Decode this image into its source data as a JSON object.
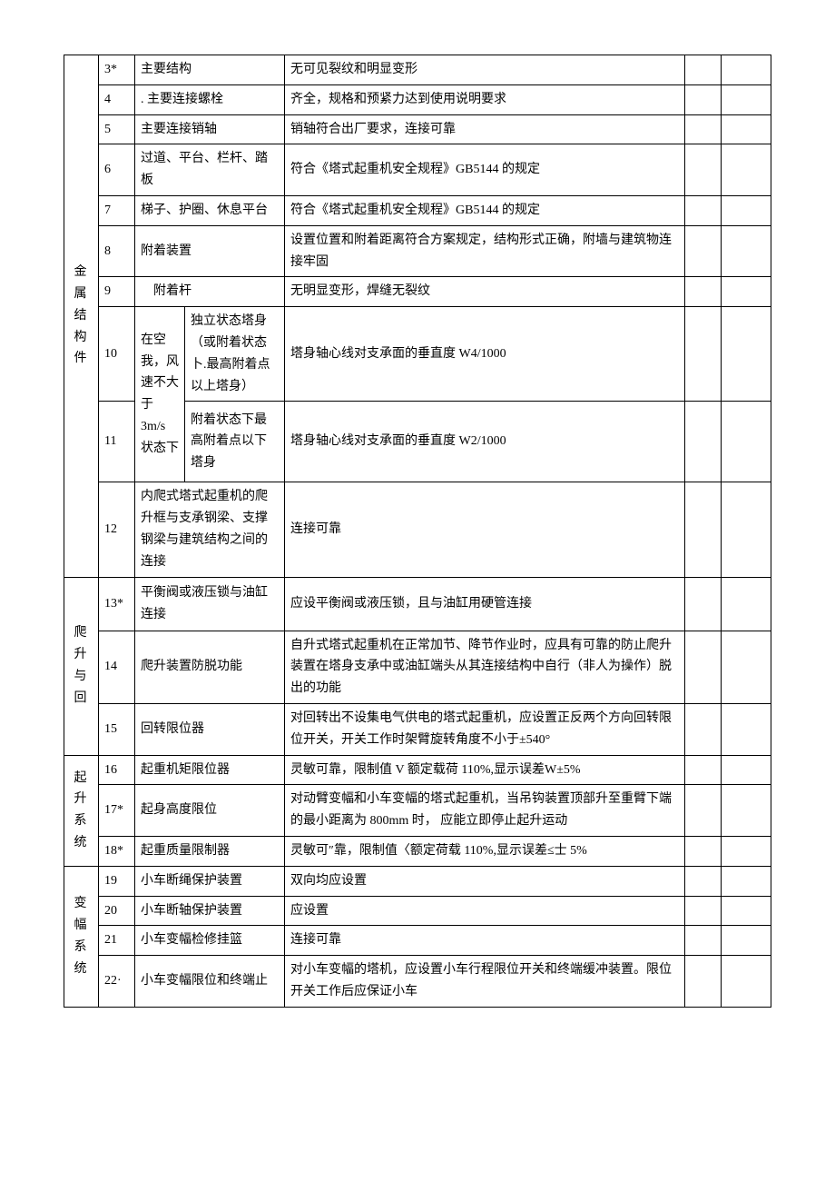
{
  "sections": {
    "s1": "金 属 结 构 件",
    "s2": "爬 升 与回",
    "s3": "起 升 系统",
    "s4": "变 幅 系统"
  },
  "sub": {
    "r10cond": "在空我，风速不大于 3m/s 状",
    "r10a": "独立状态塔身（或附着状态卜.最高附着点以上塔身）",
    "r11cond": "态下",
    "r11a": "附着状态下最高附着点以下塔身"
  },
  "rows": {
    "r3": {
      "n": "3*",
      "item": "主要结构",
      "req": "无可见裂纹和明显变形"
    },
    "r4": {
      "n": "4",
      "item": ". 主要连接螺栓",
      "req": "齐全，规格和预紧力达到使用说明要求"
    },
    "r5": {
      "n": "5",
      "item": "主要连接销轴",
      "req": "销轴符合出厂要求，连接可靠"
    },
    "r6": {
      "n": "6",
      "item": "过道、平台、栏杆、踏板",
      "req": "符合《塔式起重机安全规程》GB5144 的规定"
    },
    "r7": {
      "n": "7",
      "item": "梯子、护圈、休息平台",
      "req": "符合《塔式起重机安全规程》GB5144 的规定"
    },
    "r8": {
      "n": "8",
      "item": "附着装置",
      "req": "设置位置和附着距离符合方案规定，结构形式正确，附墙与建筑物连接牢固"
    },
    "r9": {
      "n": "9",
      "item": "附着杆",
      "req": "无明显变形，焊缝无裂纹"
    },
    "r10": {
      "n": "10",
      "req": "塔身轴心线对支承面的垂直度 W4/1000"
    },
    "r11": {
      "n": "11",
      "req": "塔身轴心线对支承面的垂直度 W2/1000"
    },
    "r12": {
      "n": "12",
      "item": "内爬式塔式起重机的爬升框与支承钢梁、支撑钢梁与建筑结构之间的连接",
      "req": "连接可靠"
    },
    "r13": {
      "n": "13*",
      "item": "平衡阀或液压锁与油缸连接",
      "req": "应设平衡阀或液压锁，且与油缸用硬管连接"
    },
    "r14": {
      "n": "14",
      "item": "爬升装置防脱功能",
      "req": "自升式塔式起重机在正常加节、降节作业时，应具有可靠的防止爬升装置在塔身支承中或油缸端头从其连接结构中自行（非人为操作）脱出的功能"
    },
    "r15": {
      "n": "15",
      "item": "回转限位器",
      "req": "对回转出不设集电气供电的塔式起重机，应设置正反两个方向回转限位开关，开关工作时架臂旋转角度不小于±540°"
    },
    "r16": {
      "n": "16",
      "item": "起重机矩限位器",
      "req": "灵敏可靠，限制值 V 额定载荷 110%,显示误差W±5%"
    },
    "r17": {
      "n": "17*",
      "item": "起身高度限位",
      "req": "对动臂变幅和小车变幅的塔式起重机，当吊钩装置顶部升至重臂下端的最小距离为 800mm 时， 应能立即停止起升运动"
    },
    "r18": {
      "n": "18*",
      "item": "起重质量限制器",
      "req": "灵敏可″靠，限制值〈额定荷载 110%,显示误差≤士 5%"
    },
    "r19": {
      "n": "19",
      "item": "小车断绳保护装置",
      "req": "双向均应设置"
    },
    "r20": {
      "n": "20",
      "item": "小车断轴保护装置",
      "req": "应设置"
    },
    "r21": {
      "n": "21",
      "item": "小车变幅检修挂篮",
      "req": "连接可靠"
    },
    "r22": {
      "n": "22·",
      "item": "小车变幅限位和终端止",
      "req": "对小车变幅的塔机，应设置小车行程限位开关和终端缓冲装置。限位开关工作后应保证小车"
    }
  }
}
